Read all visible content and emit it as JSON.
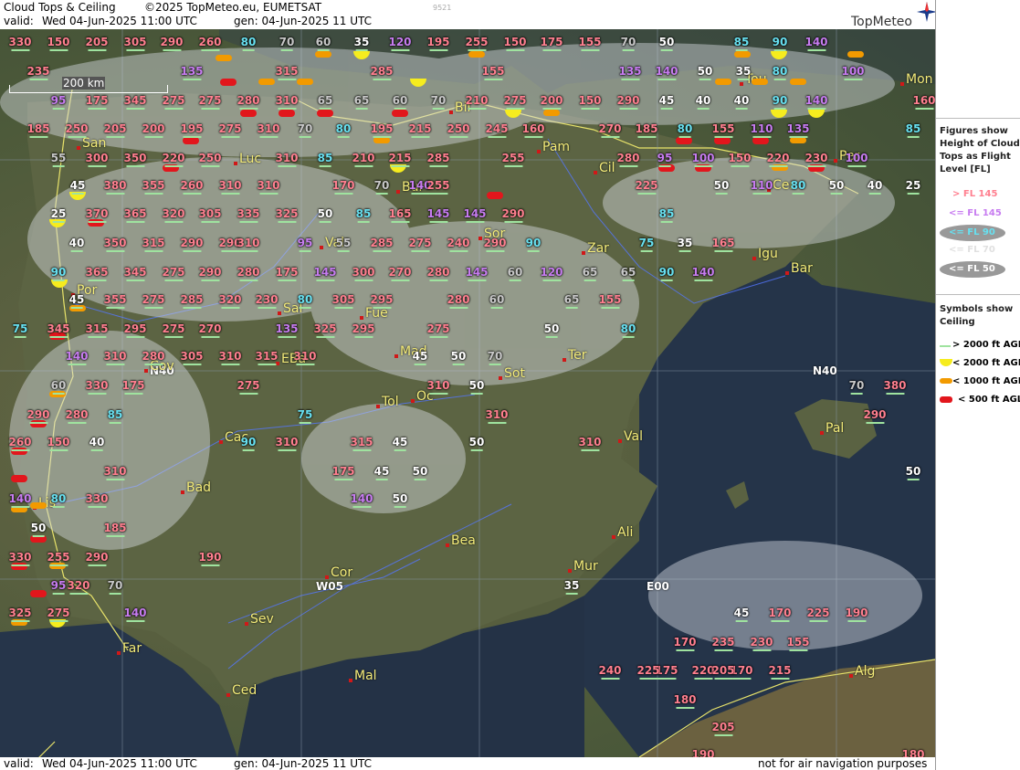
{
  "header": {
    "title": "Cloud Tops & Ceiling",
    "copyright": "©2025 TopMeteo.eu, EUMETSAT",
    "valid_label": "valid:",
    "valid_time": "Wed   04-Jun-2025   11:00 UTC",
    "gen": "gen: 04-Jun-2025 11 UTC",
    "run_id": "9521",
    "logo": "TopMeteo"
  },
  "footer": {
    "valid_label": "valid:",
    "valid_time": "Wed   04-Jun-2025   11:00 UTC",
    "gen": "gen: 04-Jun-2025 11 UTC",
    "disclaimer": "not for air navigation purposes"
  },
  "scale": {
    "label": "200 km"
  },
  "grid_labels": [
    "N40",
    "N40",
    "W05",
    "E00"
  ],
  "legend": {
    "title1": "Figures show Height of Cloud Tops as Flight Level  [FL]",
    "items": [
      {
        "text": "> FL 145",
        "color": "#ff7f8f"
      },
      {
        "text": "<= FL 145",
        "color": "#c77cf0"
      },
      {
        "text": "<= FL 90",
        "color": "#67e0f0"
      },
      {
        "text": "<= FL 70",
        "color": "#c0c0c0"
      },
      {
        "text": "<= FL 50",
        "color": "#ffffff"
      }
    ],
    "title2": "Symbols show Ceiling",
    "symbols": [
      {
        "text": "> 2000 ft AGL",
        "kind": "line"
      },
      {
        "text": "< 2000 ft AGL",
        "kind": "yellow"
      },
      {
        "text": "< 1000 ft AGL",
        "kind": "orange"
      },
      {
        "text": "< 500 ft AGL",
        "kind": "red"
      }
    ]
  },
  "colors": {
    "high": "#ff7f8f",
    "mid": "#c77cf0",
    "fl90": "#67e0f0",
    "fl70": "#c8c8c8",
    "fl50": "#ffffff",
    "city": "#f4ec7a",
    "border": "#e8e36a",
    "river": "#5577ff"
  },
  "cities": [
    "Bil",
    "San",
    "Pam",
    "Luc",
    "Cil",
    "Per",
    "Cer",
    "Bur",
    "Sor",
    "Zar",
    "Igu",
    "Bar",
    "Val",
    "Por",
    "Sal",
    "Fue",
    "Mad",
    "EBa",
    "Cov",
    "Ter",
    "Tol",
    "Oc",
    "Sot",
    "Cac",
    "Val",
    "Bad",
    "Lis",
    "Ali",
    "Bea",
    "Mur",
    "Cor",
    "Sev",
    "Far",
    "Ced",
    "Mal",
    "Pal",
    "Tou",
    "Mon",
    "Alg"
  ],
  "fl_labels": [
    "330",
    "150",
    "205",
    "305",
    "290",
    "260",
    "80",
    "70",
    "60",
    "35",
    "120",
    "195",
    "255",
    "150",
    "175",
    "155",
    "70",
    "50",
    "85",
    "90",
    "140",
    "235",
    "135",
    "315",
    "285",
    "155",
    "135",
    "140",
    "50",
    "35",
    "80",
    "100",
    "95",
    "175",
    "345",
    "275",
    "275",
    "280",
    "310",
    "65",
    "65",
    "60",
    "70",
    "210",
    "275",
    "200",
    "150",
    "290",
    "45",
    "40",
    "40",
    "90",
    "140",
    "160",
    "185",
    "250",
    "205",
    "200",
    "195",
    "275",
    "310",
    "70",
    "80",
    "195",
    "215",
    "250",
    "245",
    "160",
    "270",
    "185",
    "80",
    "155",
    "110",
    "135",
    "85",
    "55",
    "300",
    "350",
    "220",
    "250",
    "310",
    "85",
    "210",
    "215",
    "285",
    "255",
    "280",
    "95",
    "100",
    "150",
    "220",
    "230",
    "100",
    "45",
    "380",
    "355",
    "260",
    "310",
    "310",
    "170",
    "70",
    "140",
    "255",
    "225",
    "50",
    "110",
    "80",
    "50",
    "40",
    "25",
    "25",
    "370",
    "365",
    "320",
    "305",
    "335",
    "325",
    "50",
    "85",
    "165",
    "145",
    "145",
    "290",
    "85",
    "40",
    "350",
    "315",
    "290",
    "290",
    "310",
    "95",
    "55",
    "285",
    "275",
    "240",
    "290",
    "90",
    "75",
    "35",
    "165",
    "90",
    "365",
    "345",
    "275",
    "290",
    "280",
    "175",
    "145",
    "300",
    "270",
    "280",
    "145",
    "60",
    "120",
    "65",
    "65",
    "90",
    "140",
    "45",
    "355",
    "275",
    "285",
    "320",
    "230",
    "80",
    "305",
    "295",
    "280",
    "60",
    "65",
    "155",
    "75",
    "345",
    "315",
    "295",
    "275",
    "270",
    "135",
    "325",
    "295",
    "275",
    "50",
    "80",
    "140",
    "310",
    "280",
    "305",
    "310",
    "315",
    "310",
    "45",
    "50",
    "70",
    "60",
    "330",
    "175",
    "275",
    "310",
    "50",
    "70",
    "380",
    "290",
    "280",
    "85",
    "75",
    "310",
    "290",
    "260",
    "150",
    "40",
    "90",
    "310",
    "315",
    "45",
    "50",
    "310",
    "310",
    "175",
    "45",
    "50",
    "50",
    "140",
    "80",
    "330",
    "140",
    "50",
    "50",
    "185",
    "330",
    "255",
    "290",
    "190",
    "95",
    "320",
    "70",
    "35",
    "325",
    "275",
    "140",
    "45",
    "170",
    "225",
    "190",
    "170",
    "235",
    "230",
    "155",
    "175",
    "220",
    "170",
    "215",
    "240",
    "225",
    "205",
    "190",
    "180",
    "205",
    "180",
    "190"
  ]
}
